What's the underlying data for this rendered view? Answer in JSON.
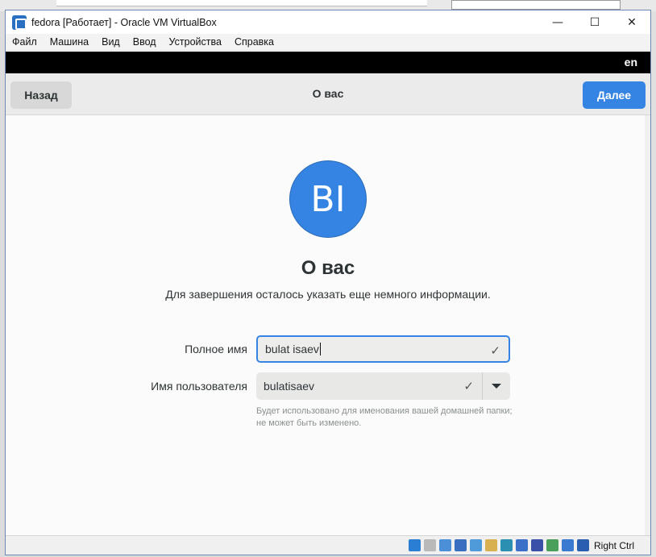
{
  "window": {
    "title": "fedora [Работает] - Oracle VM VirtualBox",
    "controls": {
      "minimize": "—",
      "maximize": "☐",
      "close": "✕"
    }
  },
  "menubar": {
    "items": [
      "Файл",
      "Машина",
      "Вид",
      "Ввод",
      "Устройства",
      "Справка"
    ]
  },
  "guest": {
    "topbar": {
      "language": "en"
    },
    "header": {
      "back_label": "Назад",
      "title": "О вас",
      "next_label": "Далее"
    },
    "avatar": {
      "initials": "BI"
    },
    "heading": "О вас",
    "subtitle": "Для завершения осталось указать еще немного информации.",
    "full_name": {
      "label": "Полное имя",
      "value": "bulat isaev"
    },
    "username": {
      "label": "Имя пользователя",
      "value": "bulatisaev"
    },
    "hint": "Будет использовано для именования вашей домашней папки; не может быть изменено."
  },
  "statusbar": {
    "host_key": "Right Ctrl",
    "icons": [
      "hard-disk-icon",
      "optical-drive-icon",
      "audio-icon",
      "network-icon",
      "usb-icon",
      "shared-folders-icon",
      "display-icon",
      "video-capture-icon",
      "cpu-icon",
      "guest-additions-icon",
      "mouse-integration-icon",
      "keyboard-capture-icon"
    ],
    "icon_colors": [
      "#2a7fd4",
      "#b9b9b9",
      "#4a8fd8",
      "#3a6fc0",
      "#4f9ad8",
      "#d9b050",
      "#2a8fb0",
      "#3b6fc8",
      "#3a4fa8",
      "#4aa05a",
      "#3a7ad0",
      "#2a5fb0"
    ]
  }
}
